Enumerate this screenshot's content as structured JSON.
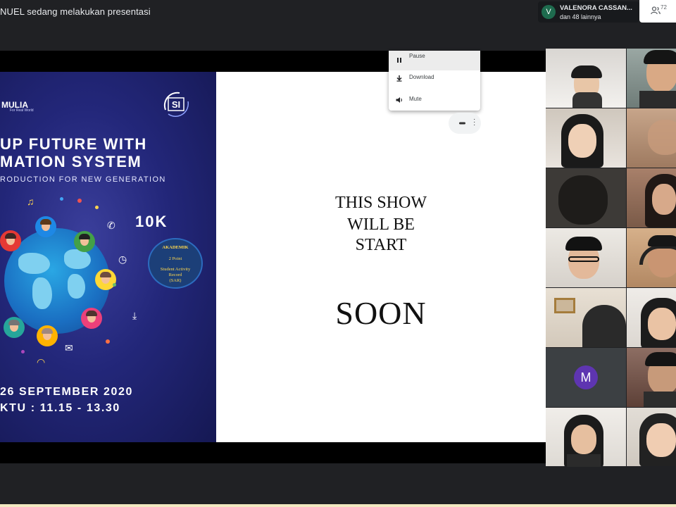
{
  "meeting": {
    "presenter_text": "NUEL sedang melakukan presentasi",
    "participant_chip": {
      "avatar_letter": "V",
      "name": "VALENORA CASSAN...",
      "others": "dan 48 lainnya"
    },
    "people_count": "72"
  },
  "poster": {
    "brand": "MULIA",
    "brand_tagline": "For Real World",
    "logo_text": "SI",
    "title_line1": "UP FUTURE WITH",
    "title_line2": "MATION SYSTEM",
    "subtitle": "RODUCTION FOR NEW GENERATION",
    "prize": "10K",
    "badge": {
      "line1": "AKADEMIK",
      "line2": "2 Point",
      "line3": "Student Activity",
      "line4": "Record",
      "line5": "(SAR)"
    },
    "date": "26 SEPTEMBER 2020",
    "time": "KTU : 11.15 - 13.30"
  },
  "slide": {
    "line1": "THIS SHOW",
    "line2": "WILL BE",
    "line3": "START",
    "line4": "SOON"
  },
  "player_menu": {
    "items": [
      {
        "label": "Pause",
        "icon": "pause-icon"
      },
      {
        "label": "Download",
        "icon": "download-icon"
      },
      {
        "label": "Mute",
        "icon": "volume-icon"
      }
    ]
  },
  "participants": {
    "tiles": [
      {
        "label": ""
      },
      {
        "label": ""
      },
      {
        "label": ""
      },
      {
        "label": ""
      },
      {
        "label": ""
      },
      {
        "label": ""
      },
      {
        "label": ""
      },
      {
        "label": ""
      },
      {
        "label": ""
      },
      {
        "label": ""
      },
      {
        "label": "",
        "avatar_letter": "M"
      },
      {
        "label": ""
      },
      {
        "label": ""
      },
      {
        "label": ""
      }
    ]
  },
  "colors": {
    "background": "#202124",
    "poster_navy": "#23277a",
    "avatar_purple": "#5e35b1",
    "chip_green": "#1e6b4e"
  }
}
